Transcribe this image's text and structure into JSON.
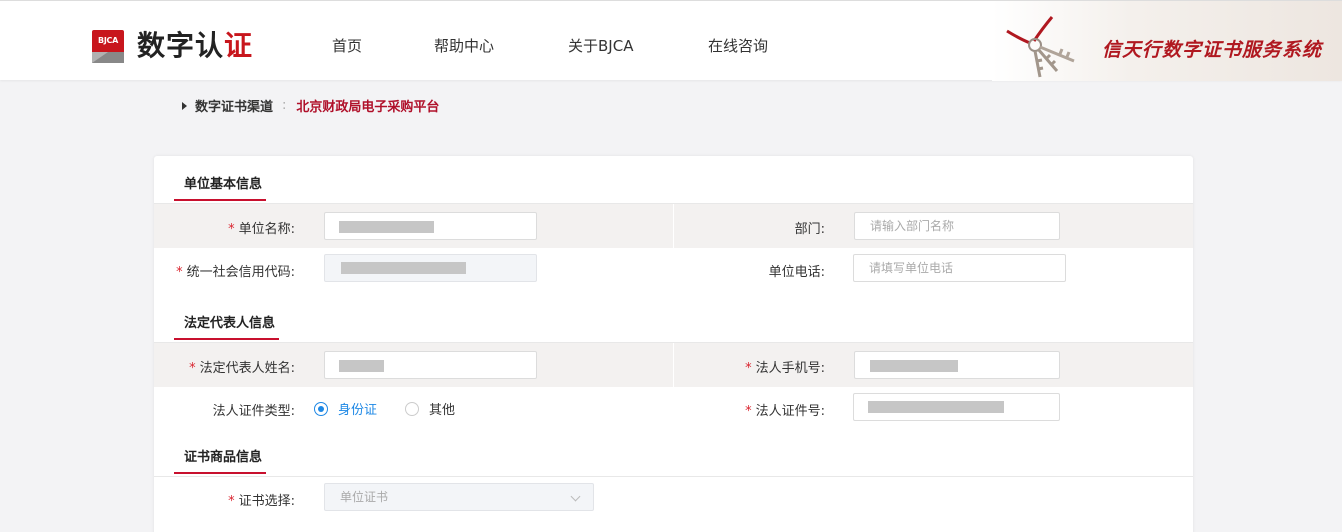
{
  "header": {
    "logo_badge": "BJCA",
    "logo_text_main": "数字认",
    "logo_text_check": "证",
    "nav": [
      {
        "label": "首页"
      },
      {
        "label": "帮助中心"
      },
      {
        "label": "关于BJCA"
      },
      {
        "label": "在线咨询"
      }
    ],
    "slogan": "信天行数字证书服务系统"
  },
  "breadcrumb": {
    "label": "数字证书渠道",
    "separator": ":",
    "value": "北京财政局电子采购平台"
  },
  "sections": {
    "unit": {
      "title": "单位基本信息",
      "unit_name": {
        "label": "单位名称:",
        "required": "*"
      },
      "department": {
        "label": "部门:",
        "placeholder": "请输入部门名称"
      },
      "credit_code": {
        "label": "统一社会信用代码:",
        "required": "*"
      },
      "unit_phone": {
        "label": "单位电话:",
        "placeholder": "请填写单位电话"
      }
    },
    "legal": {
      "title": "法定代表人信息",
      "name": {
        "label": "法定代表人姓名:",
        "required": "*"
      },
      "mobile": {
        "label": "法人手机号:",
        "required": "*"
      },
      "id_type": {
        "label": "法人证件类型:",
        "options": [
          "身份证",
          "其他"
        ],
        "selected": "身份证"
      },
      "id_number": {
        "label": "法人证件号:",
        "required": "*"
      }
    },
    "product": {
      "title": "证书商品信息",
      "cert": {
        "label": "证书选择:",
        "required": "*",
        "value": "单位证书"
      }
    }
  },
  "colors": {
    "brand_red": "#c8161d",
    "accent_blue": "#1e88e5",
    "required_red": "#d9232e"
  }
}
